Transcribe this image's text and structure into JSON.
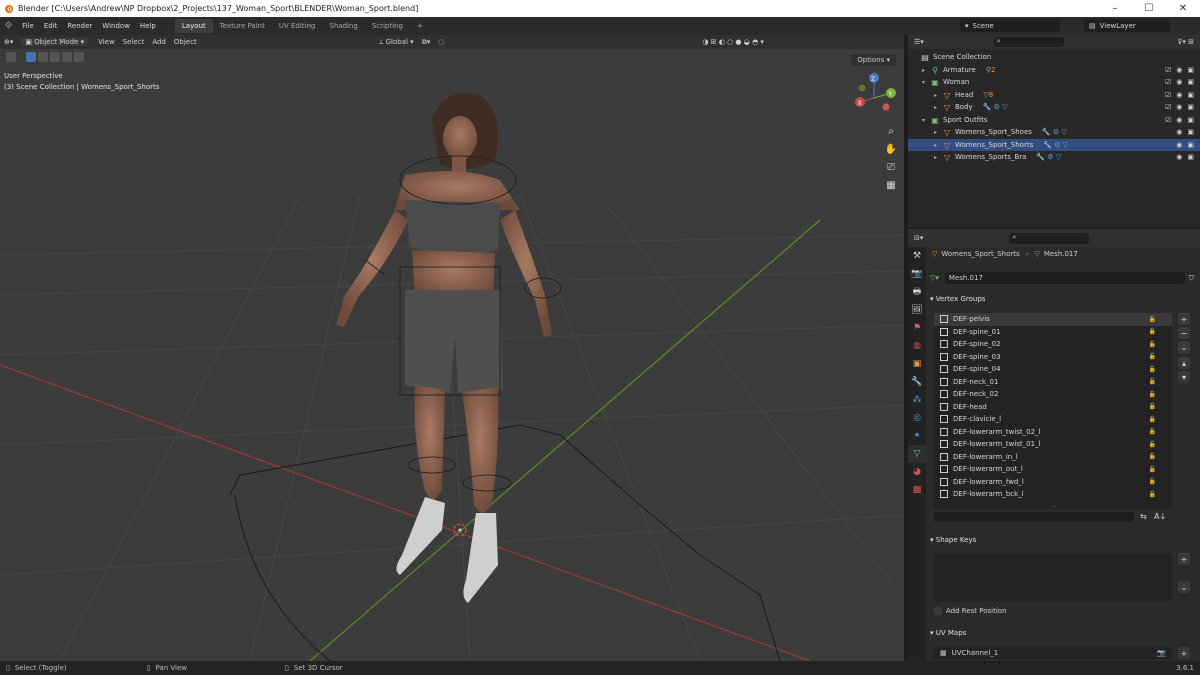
{
  "titlebar": {
    "title": "Blender [C:\\Users\\Andrew\\NP Dropbox\\2_Projects\\137_Woman_Sport\\BLENDER\\Woman_Sport.blend]",
    "controls": [
      "–",
      "☐",
      "✕"
    ]
  },
  "topbar": {
    "menus": [
      "File",
      "Edit",
      "Render",
      "Window",
      "Help"
    ],
    "workspaces": [
      "Layout",
      "Texture Paint",
      "UV Editing",
      "Shading",
      "Scripting"
    ],
    "active_workspace": "Layout",
    "add_tab": "+",
    "scene": "Scene",
    "view_layer": "ViewLayer"
  },
  "viewport": {
    "mode": "Object Mode",
    "menus": [
      "View",
      "Select",
      "Add",
      "Object"
    ],
    "orientation": "Global",
    "overlay_line1": "User Perspective",
    "overlay_line2": "(3) Scene Collection | Womens_Sport_Shorts",
    "options": "Options",
    "gizmo": {
      "x": "X",
      "y": "Y",
      "z": "Z"
    }
  },
  "outliner": {
    "root": "Scene Collection",
    "rows": [
      {
        "label": "Armature",
        "icon": "armature-icon",
        "extra": "⚲2"
      },
      {
        "label": "Woman",
        "icon": "collection-icon",
        "extra": ""
      },
      {
        "label": "Head",
        "icon": "mesh-icon",
        "extra": "▽8"
      },
      {
        "label": "Body",
        "icon": "mesh-icon",
        "extra": ""
      },
      {
        "label": "Sport Outfits",
        "icon": "collection-icon",
        "extra": ""
      },
      {
        "label": "Womens_Sport_Shoes",
        "icon": "mesh-icon",
        "extra": ""
      },
      {
        "label": "Womens_Sport_Shorts",
        "icon": "mesh-icon",
        "extra": ""
      },
      {
        "label": "Womens_Sports_Bra",
        "icon": "mesh-icon",
        "extra": ""
      }
    ]
  },
  "properties": {
    "object": "Womens_Sport_Shorts",
    "mesh": "Mesh.017",
    "mesh_field": "Mesh.017",
    "vertex_groups_title": "Vertex Groups",
    "vertex_groups": [
      "DEF-pelvis",
      "DEF-spine_01",
      "DEF-spine_02",
      "DEF-spine_03",
      "DEF-spine_04",
      "DEF-neck_01",
      "DEF-neck_02",
      "DEF-head",
      "DEF-clavicle_l",
      "DEF-lowerarm_twist_02_l",
      "DEF-lowerarm_twist_01_l",
      "DEF-lowerarm_in_l",
      "DEF-lowerarm_out_l",
      "DEF-lowerarm_fwd_l",
      "DEF-lowerarm_bck_l"
    ],
    "shape_keys_title": "Shape Keys",
    "add_rest_position": "Add Rest Position",
    "uv_maps_title": "UV Maps",
    "uv_channel": "UVChannel_1"
  },
  "statusbar": {
    "items": [
      "Select (Toggle)",
      "Pan View",
      "Set 3D Cursor"
    ],
    "version": "3.6.1"
  },
  "colors": {
    "accent": "#4772b3",
    "selection": "#334d80",
    "x_axis": "#b33a3a",
    "y_axis": "#6d9b2f",
    "collection": "#7fbf7f",
    "mesh": "#e49a4a"
  }
}
